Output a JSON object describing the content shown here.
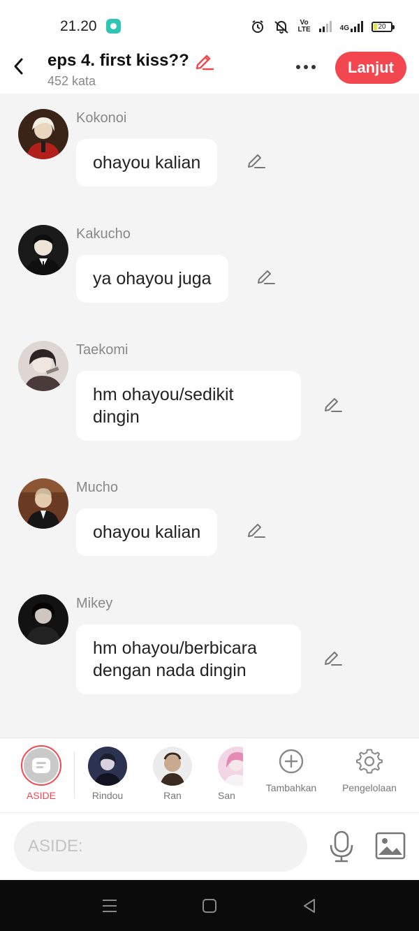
{
  "status_bar": {
    "time": "21.20",
    "volte_label": "Vo\nLTE",
    "network_label": "4G",
    "battery_level": "20",
    "battery_percent": 20
  },
  "header": {
    "title": "eps 4. first kiss??",
    "word_count": "452 kata",
    "next_button": "Lanjut"
  },
  "messages": [
    {
      "name": "Kokonoi",
      "text": "ohayou kalian"
    },
    {
      "name": "Kakucho",
      "text": "ya ohayou juga"
    },
    {
      "name": "Taekomi",
      "text": "hm ohayou/sedikit dingin"
    },
    {
      "name": "Mucho",
      "text": "ohayou kalian"
    },
    {
      "name": "Mikey",
      "text": "hm ohayou/berbicara dengan nada dingin"
    }
  ],
  "characters": {
    "aside_label": "ASIDE",
    "items": [
      {
        "label": "Rindou"
      },
      {
        "label": "Ran"
      },
      {
        "label": "San"
      }
    ],
    "add_label": "Tambahkan",
    "manage_label": "Pengelolaan"
  },
  "input": {
    "placeholder": "ASIDE:"
  },
  "colors": {
    "accent": "#f2474f",
    "background": "#f4f4f4",
    "bubble": "#ffffff",
    "name_text": "#888888"
  }
}
